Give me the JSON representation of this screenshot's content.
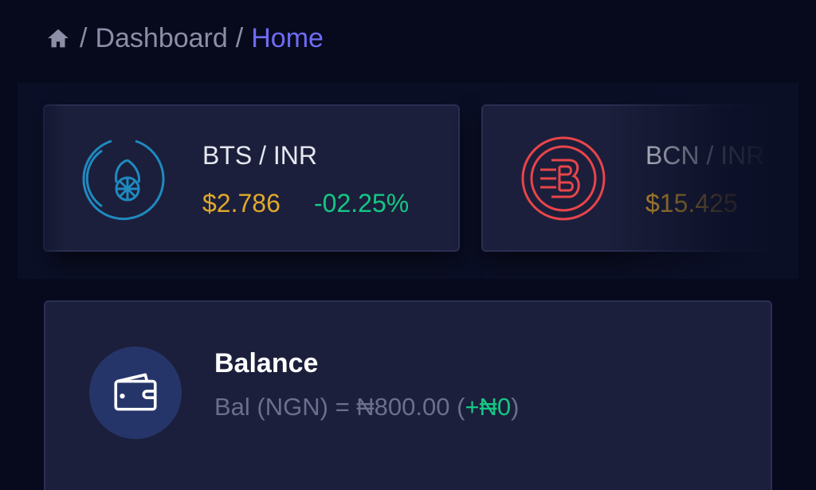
{
  "breadcrumb": {
    "home_icon": "home-icon",
    "separator": "/",
    "items": [
      {
        "label": "Dashboard"
      },
      {
        "label": "Home"
      }
    ]
  },
  "tickers": [
    {
      "icon": "bitshares-icon",
      "pair": "BTS / INR",
      "price": "$2.786",
      "change": "-02.25%",
      "price_color": "#e0a82d",
      "change_color": "#14c784",
      "icon_color": "#1f8ac0"
    },
    {
      "icon": "bytecoin-icon",
      "pair": "BCN / INR",
      "price": "$15.425",
      "price_color": "#e0a82d",
      "icon_color": "#e8454a"
    }
  ],
  "balance": {
    "icon": "wallet-icon",
    "title": "Balance",
    "label": "Bal (NGN) = ",
    "amount": "₦800.00",
    "open_paren": " (",
    "delta": "+₦0",
    "close_paren": ")",
    "delta_color": "#14c784"
  },
  "colors": {
    "background": "#070a1d",
    "card": "#1b1f3b",
    "accent": "#6f6cf5"
  }
}
